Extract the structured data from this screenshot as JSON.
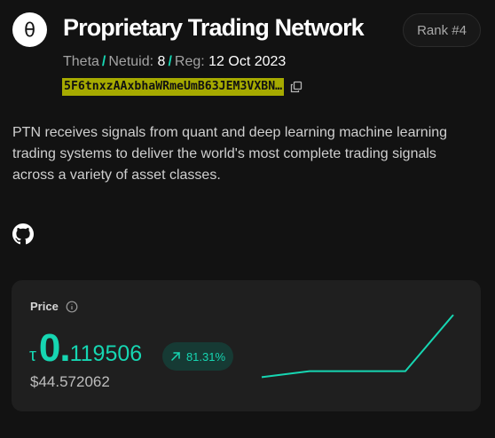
{
  "subnet": {
    "logo_symbol": "θ",
    "title": "Proprietary Trading Network",
    "rank": "Rank #4",
    "meta": {
      "name": "Theta",
      "separator": "/",
      "netuid_label": "Netuid:",
      "netuid": "8",
      "reg_label": "Reg:",
      "reg_date": "12 Oct 2023"
    },
    "address": "5F6tnxzAAxbhaWRmeUmB63JEM3VXBN…",
    "description": "PTN receives signals from quant and deep learning machine learning trading systems to deliver the world's most complete trading signals across a variety of asset classes.",
    "links": {
      "github_icon": "github-icon"
    }
  },
  "price_card": {
    "label": "Price",
    "info_icon": "info-icon",
    "currency_symbol": "τ",
    "price_integer": "0.",
    "price_decimal": "119506",
    "change": "81.31%",
    "change_icon": "arrow-up-right-icon",
    "usd_price": "$44.572062",
    "accent_color": "#16d6b2"
  },
  "chart_data": {
    "type": "line",
    "title": "",
    "x": [
      0,
      1,
      2,
      3,
      4
    ],
    "series": [
      {
        "values": [
          0.058,
          0.064,
          0.064,
          0.064,
          0.1195
        ]
      }
    ],
    "ylim": [
      0.054,
      0.124
    ],
    "grid": false,
    "color": "#16d6b2"
  }
}
